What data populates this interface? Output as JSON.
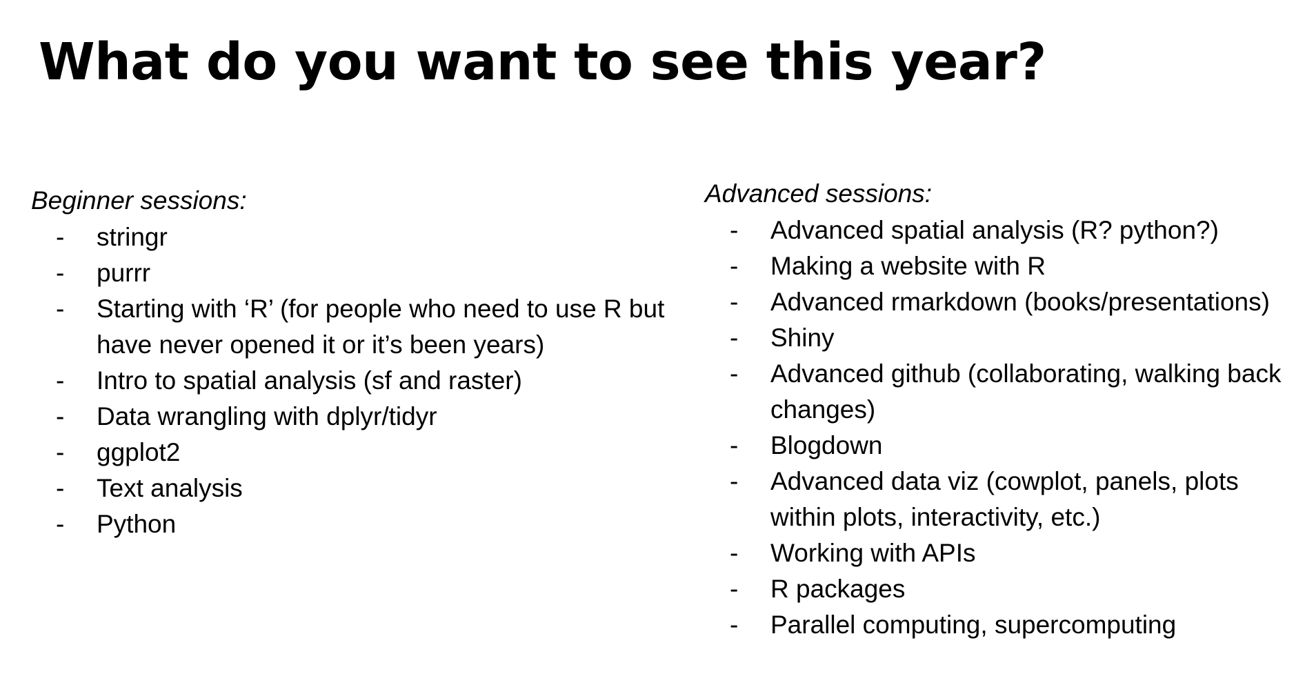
{
  "title": "What do you want to see this year?",
  "beginner": {
    "heading": "Beginner sessions:",
    "bullet": "-",
    "items": [
      "stringr",
      "purrr",
      "Starting with ‘R’ (for people who need to use R but have never opened it or it’s been years)",
      "Intro to spatial analysis (sf and raster)",
      "Data wrangling with dplyr/tidyr",
      "ggplot2",
      "Text analysis",
      "Python"
    ]
  },
  "advanced": {
    "heading": "Advanced sessions:",
    "bullet": "-",
    "items": [
      "Advanced spatial analysis (R? python?)",
      "Making a website with R",
      "Advanced rmarkdown (books/presentations)",
      "Shiny",
      "Advanced github (collaborating, walking back changes)",
      "Blogdown",
      "Advanced data viz (cowplot, panels, plots within plots, interactivity, etc.)",
      "Working with APIs",
      "R packages",
      "Parallel computing, supercomputing"
    ]
  }
}
